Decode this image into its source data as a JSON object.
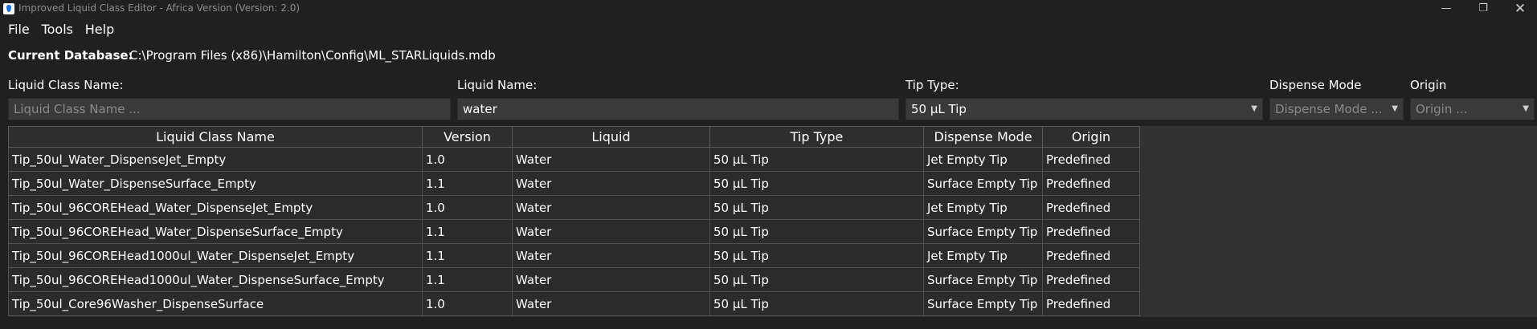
{
  "window": {
    "title": "Improved Liquid Class Editor - Africa Version (Version: 2.0)",
    "controls": {
      "minimize": "—",
      "maximize": "❐",
      "close": "✕"
    }
  },
  "menu": [
    "File",
    "Tools",
    "Help"
  ],
  "database": {
    "label": "Current Database:",
    "path": "C:\\Program Files (x86)\\Hamilton\\Config\\ML_STARLiquids.mdb"
  },
  "filters": {
    "liquid_class_name": {
      "label": "Liquid Class Name:",
      "value": "",
      "placeholder": "Liquid Class Name ..."
    },
    "liquid_name": {
      "label": "Liquid Name:",
      "value": "water"
    },
    "tip_type": {
      "label": "Tip Type:",
      "value": "50 µL Tip"
    },
    "dispense_mode": {
      "label": "Dispense Mode",
      "placeholder": "Dispense Mode ..."
    },
    "origin": {
      "label": "Origin",
      "placeholder": "Origin ..."
    }
  },
  "table": {
    "columns": [
      "Liquid Class Name",
      "Version",
      "Liquid",
      "Tip Type",
      "Dispense Mode",
      "Origin"
    ],
    "rows": [
      [
        "Tip_50ul_Water_DispenseJet_Empty",
        "1.0",
        "Water",
        "50 µL Tip",
        "Jet Empty Tip",
        "Predefined"
      ],
      [
        "Tip_50ul_Water_DispenseSurface_Empty",
        "1.1",
        "Water",
        "50 µL Tip",
        "Surface Empty Tip",
        "Predefined"
      ],
      [
        "Tip_50ul_96COREHead_Water_DispenseJet_Empty",
        "1.0",
        "Water",
        "50 µL Tip",
        "Jet Empty Tip",
        "Predefined"
      ],
      [
        "Tip_50ul_96COREHead_Water_DispenseSurface_Empty",
        "1.1",
        "Water",
        "50 µL Tip",
        "Surface Empty Tip",
        "Predefined"
      ],
      [
        "Tip_50ul_96COREHead1000ul_Water_DispenseJet_Empty",
        "1.1",
        "Water",
        "50 µL Tip",
        "Jet Empty Tip",
        "Predefined"
      ],
      [
        "Tip_50ul_96COREHead1000ul_Water_DispenseSurface_Empty",
        "1.1",
        "Water",
        "50 µL Tip",
        "Surface Empty Tip",
        "Predefined"
      ],
      [
        "Tip_50ul_Core96Washer_DispenseSurface",
        "1.0",
        "Water",
        "50 µL Tip",
        "Surface Empty Tip",
        "Predefined"
      ]
    ]
  }
}
